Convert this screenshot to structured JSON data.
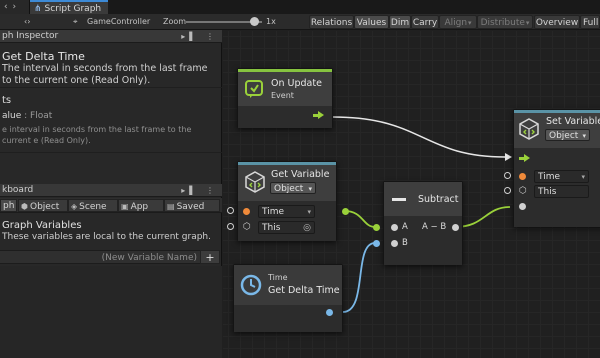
{
  "tabs": {
    "left_tab_glyph": "‹ ›",
    "main_tab_label": "Script Graph"
  },
  "toolbar": {
    "nav_glyph": "‹›",
    "breadcrumb": "GameController",
    "zoom_label": "Zoom",
    "zoom_value": "1x",
    "zoom_level": 0.9,
    "buttons": {
      "relations": "Relations",
      "values": "Values",
      "dim": "Dim",
      "carry": "Carry",
      "align": "Align",
      "distribute": "Distribute",
      "overview": "Overview",
      "full": "Full"
    }
  },
  "graph_inspector": {
    "header": "ph Inspector",
    "title": "Get Delta Time",
    "description": "The interval in seconds from the last frame to the current one (Read Only).",
    "section": "ts",
    "value_name": "alue",
    "value_type": ": Float",
    "value_description": "e interval in seconds from the last frame to the current e (Read Only)."
  },
  "blackboard": {
    "header": "kboard",
    "tabs": [
      "ph",
      "Object",
      "Scene",
      "App",
      "Saved"
    ],
    "title": "Graph Variables",
    "description": "These variables are local to the current graph.",
    "new_variable_placeholder": "(New Variable Name)",
    "add_label": "+"
  },
  "nodes": {
    "on_update": {
      "title": "On Update",
      "subtitle": "Event"
    },
    "get_variable": {
      "title": "Get Variable",
      "kind": "Object",
      "name_value": "Time",
      "target_value": "This"
    },
    "subtract": {
      "title": "Subtract",
      "input_a": "A",
      "input_b": "B",
      "output": "A − B"
    },
    "get_delta_time": {
      "category": "Time",
      "title": "Get Delta Time"
    },
    "set_variable": {
      "title": "Set Variable",
      "kind": "Object",
      "name_value": "Time",
      "target_value": "This"
    }
  },
  "colors": {
    "accent_flow": "#9ad13a",
    "accent_value": "#7ab8e8",
    "orange_port": "#f08a3a",
    "event_accent": "#86c340",
    "tab_highlight": "#3d8ad6"
  },
  "icons": [
    "gear-icon",
    "lock-icon",
    "menu-icon",
    "game-controller-icon",
    "update-loop-icon",
    "variable-cube-icon",
    "subtract-icon",
    "clock-icon",
    "target-icon"
  ]
}
